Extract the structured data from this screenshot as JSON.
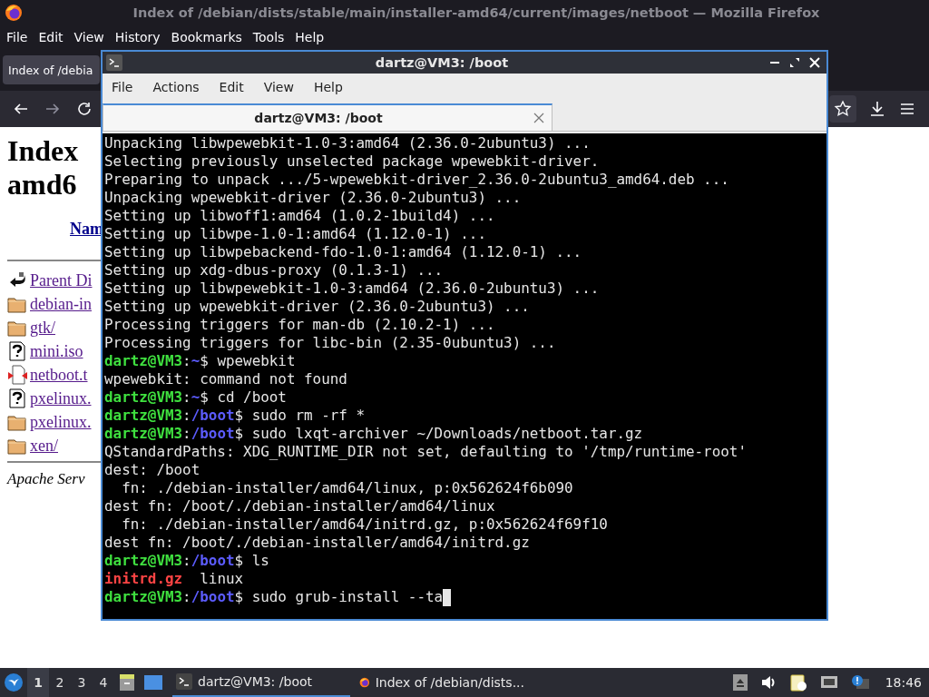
{
  "firefox": {
    "title": "Index of /debian/dists/stable/main/installer-amd64/current/images/netboot — Mozilla Firefox",
    "menu": [
      "File",
      "Edit",
      "View",
      "History",
      "Bookmarks",
      "Tools",
      "Help"
    ],
    "tab": {
      "title": "Index of /debia",
      "selected": true
    },
    "page": {
      "heading": [
        "Index",
        "amd6"
      ],
      "column_header": "Nam",
      "entries": [
        {
          "kind": "back",
          "name": "Parent Di"
        },
        {
          "kind": "folder",
          "name": "debian-in"
        },
        {
          "kind": "folder",
          "name": "gtk/"
        },
        {
          "kind": "unknown",
          "name": "mini.iso"
        },
        {
          "kind": "archive",
          "name": "netboot.t"
        },
        {
          "kind": "unknown",
          "name": "pxelinux."
        },
        {
          "kind": "folder",
          "name": "pxelinux."
        },
        {
          "kind": "folder",
          "name": "xen/"
        }
      ],
      "footer": "Apache Serv"
    }
  },
  "terminal": {
    "title": "dartz@VM3: /boot",
    "menu": [
      "File",
      "Actions",
      "Edit",
      "View",
      "Help"
    ],
    "tab": {
      "title": "dartz@VM3: /boot",
      "selected": true
    },
    "lines": [
      [
        {
          "kind": "text",
          "text": "Unpacking libwpewebkit-1.0-3:amd64 (2.36.0-2ubuntu3) ..."
        }
      ],
      [
        {
          "kind": "text",
          "text": "Selecting previously unselected package wpewebkit-driver."
        }
      ],
      [
        {
          "kind": "text",
          "text": "Preparing to unpack .../5-wpewebkit-driver_2.36.0-2ubuntu3_amd64.deb ..."
        }
      ],
      [
        {
          "kind": "text",
          "text": "Unpacking wpewebkit-driver (2.36.0-2ubuntu3) ..."
        }
      ],
      [
        {
          "kind": "text",
          "text": "Setting up libwoff1:amd64 (1.0.2-1build4) ..."
        }
      ],
      [
        {
          "kind": "text",
          "text": "Setting up libwpe-1.0-1:amd64 (1.12.0-1) ..."
        }
      ],
      [
        {
          "kind": "text",
          "text": "Setting up libwpebackend-fdo-1.0-1:amd64 (1.12.0-1) ..."
        }
      ],
      [
        {
          "kind": "text",
          "text": "Setting up xdg-dbus-proxy (0.1.3-1) ..."
        }
      ],
      [
        {
          "kind": "text",
          "text": "Setting up libwpewebkit-1.0-3:amd64 (2.36.0-2ubuntu3) ..."
        }
      ],
      [
        {
          "kind": "text",
          "text": "Setting up wpewebkit-driver (2.36.0-2ubuntu3) ..."
        }
      ],
      [
        {
          "kind": "text",
          "text": "Processing triggers for man-db (2.10.2-1) ..."
        }
      ],
      [
        {
          "kind": "text",
          "text": "Processing triggers for libc-bin (2.35-0ubuntu3) ..."
        }
      ],
      [
        {
          "kind": "user",
          "text": "dartz@VM3"
        },
        {
          "kind": "text",
          "text": ":"
        },
        {
          "kind": "path",
          "text": "~"
        },
        {
          "kind": "text",
          "text": "$ wpewebkit"
        }
      ],
      [
        {
          "kind": "text",
          "text": "wpewebkit: command not found"
        }
      ],
      [
        {
          "kind": "user",
          "text": "dartz@VM3"
        },
        {
          "kind": "text",
          "text": ":"
        },
        {
          "kind": "path",
          "text": "~"
        },
        {
          "kind": "text",
          "text": "$ cd /boot"
        }
      ],
      [
        {
          "kind": "user",
          "text": "dartz@VM3"
        },
        {
          "kind": "text",
          "text": ":"
        },
        {
          "kind": "path",
          "text": "/boot"
        },
        {
          "kind": "text",
          "text": "$ sudo rm -rf *"
        }
      ],
      [
        {
          "kind": "user",
          "text": "dartz@VM3"
        },
        {
          "kind": "text",
          "text": ":"
        },
        {
          "kind": "path",
          "text": "/boot"
        },
        {
          "kind": "text",
          "text": "$ sudo lxqt-archiver ~/Downloads/netboot.tar.gz"
        }
      ],
      [
        {
          "kind": "text",
          "text": "QStandardPaths: XDG_RUNTIME_DIR not set, defaulting to '/tmp/runtime-root'"
        }
      ],
      [
        {
          "kind": "text",
          "text": "dest: /boot"
        }
      ],
      [
        {
          "kind": "text",
          "text": "  fn: ./debian-installer/amd64/linux, p:0x562624f6b090"
        }
      ],
      [
        {
          "kind": "text",
          "text": "dest fn: /boot/./debian-installer/amd64/linux"
        }
      ],
      [
        {
          "kind": "text",
          "text": "  fn: ./debian-installer/amd64/initrd.gz, p:0x562624f69f10"
        }
      ],
      [
        {
          "kind": "text",
          "text": "dest fn: /boot/./debian-installer/amd64/initrd.gz"
        }
      ],
      [
        {
          "kind": "user",
          "text": "dartz@VM3"
        },
        {
          "kind": "text",
          "text": ":"
        },
        {
          "kind": "path",
          "text": "/boot"
        },
        {
          "kind": "text",
          "text": "$ ls"
        }
      ],
      [
        {
          "kind": "file",
          "text": "initrd.gz"
        },
        {
          "kind": "text",
          "text": "  linux"
        }
      ],
      [
        {
          "kind": "user",
          "text": "dartz@VM3"
        },
        {
          "kind": "text",
          "text": ":"
        },
        {
          "kind": "path",
          "text": "/boot"
        },
        {
          "kind": "text",
          "text": "$ sudo grub-install --ta"
        }
      ]
    ],
    "cursor": true
  },
  "taskbar": {
    "desktops": [
      {
        "label": "1",
        "selected": true
      },
      {
        "label": "2",
        "selected": false
      },
      {
        "label": "3",
        "selected": false
      },
      {
        "label": "4",
        "selected": false
      }
    ],
    "tasks": [
      {
        "kind": "terminal",
        "title": "dartz@VM3: /boot",
        "selected": true
      },
      {
        "kind": "firefox",
        "title": "Index of /debian/dists...",
        "selected": false
      }
    ],
    "clock": "18:46"
  }
}
